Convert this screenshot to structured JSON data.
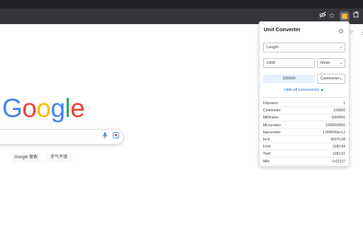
{
  "browser": {
    "toolbar_icons": [
      "eye-off-icon",
      "star-icon",
      "extension-active-icon",
      "puzzle-icon"
    ],
    "colors": {
      "frame": "#202124",
      "toolbar": "#35363a"
    }
  },
  "google": {
    "logo_letters": [
      {
        "char": "G",
        "color": "#4285f4"
      },
      {
        "char": "o",
        "color": "#ea4335"
      },
      {
        "char": "o",
        "color": "#fbbc05"
      },
      {
        "char": "g",
        "color": "#4285f4"
      },
      {
        "char": "l",
        "color": "#34a853"
      },
      {
        "char": "e",
        "color": "#ea4335"
      }
    ],
    "buttons": {
      "search": "Google 搜索",
      "lucky": "手气不错"
    }
  },
  "popup": {
    "title": "Unit Converter",
    "category": "Length",
    "input_value": "1000",
    "from_unit": "Meter",
    "result_value": "100000",
    "to_unit": "Centimeter",
    "toggle_label": "Hide all conversions ▲",
    "conversions": [
      {
        "unit": "Kilometer:",
        "value": "1"
      },
      {
        "unit": "Centimeter:",
        "value": "100000"
      },
      {
        "unit": "Millimeter:",
        "value": "1000000"
      },
      {
        "unit": "Micrometer:",
        "value": "1000000000"
      },
      {
        "unit": "Nanometer:",
        "value": "1.000000e+12"
      },
      {
        "unit": "Inch:",
        "value": "39370.08"
      },
      {
        "unit": "Foot:",
        "value": "3280.84"
      },
      {
        "unit": "Yard:",
        "value": "1093.61"
      },
      {
        "unit": "Mile:",
        "value": "0.62137"
      }
    ]
  }
}
